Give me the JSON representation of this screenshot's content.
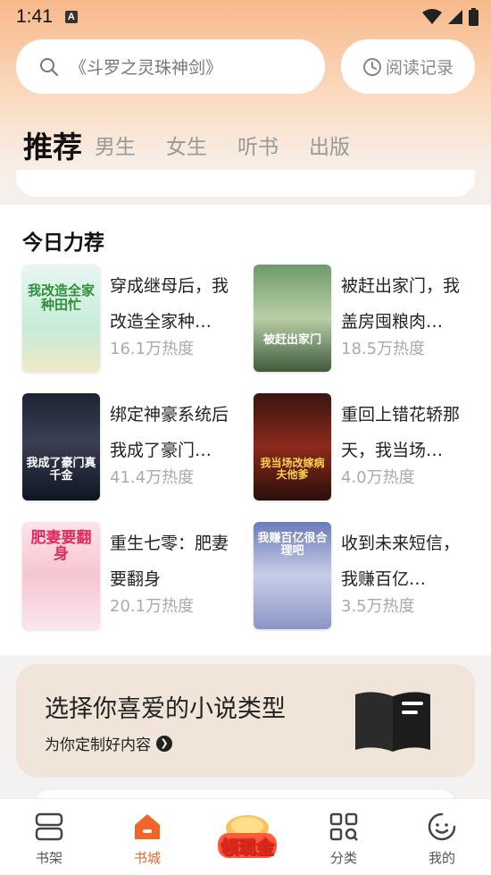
{
  "status_bar": {
    "time": "1:41",
    "notification_icon": "A"
  },
  "search": {
    "placeholder": "《斗罗之灵珠神剑》"
  },
  "history_button": {
    "label": "阅读记录"
  },
  "tabs": [
    {
      "label": "推荐",
      "active": true
    },
    {
      "label": "男生",
      "active": false
    },
    {
      "label": "女生",
      "active": false
    },
    {
      "label": "听书",
      "active": false
    },
    {
      "label": "出版",
      "active": false
    }
  ],
  "recommend": {
    "title": "今日力荐",
    "books": [
      {
        "title": "穿成继母后，我改造全家种…",
        "heat": "16.1万热度",
        "cover_text": "我改造全家种田忙"
      },
      {
        "title": "被赶出家门，我盖房囤粮肉…",
        "heat": "18.5万热度",
        "cover_text": "被赶出家门"
      },
      {
        "title": "绑定神豪系统后我成了豪门…",
        "heat": "41.4万热度",
        "cover_text": "我成了豪门真千金"
      },
      {
        "title": "重回上错花轿那天，我当场…",
        "heat": "4.0万热度",
        "cover_text": "我当场改嫁病夫他爹"
      },
      {
        "title": "重生七零：肥妻要翻身",
        "heat": "20.1万热度",
        "cover_text": "肥妻要翻身"
      },
      {
        "title": "收到未来短信，我赚百亿…",
        "heat": "3.5万热度",
        "cover_text": "我赚百亿很合理吧"
      }
    ]
  },
  "banner": {
    "title": "选择你喜爱的小说类型",
    "subtitle": "为你定制好内容"
  },
  "bottom_nav": [
    {
      "label": "书架",
      "icon": "bookshelf-icon",
      "active": false
    },
    {
      "label": "书城",
      "icon": "home-icon",
      "active": true
    },
    {
      "label": "",
      "icon": "cash-icon",
      "active": false
    },
    {
      "label": "分类",
      "icon": "category-icon",
      "active": false
    },
    {
      "label": "我的",
      "icon": "profile-icon",
      "active": false
    }
  ],
  "cash_badge": {
    "label": "领现金"
  },
  "colors": {
    "accent": "#f0652a",
    "banner_bg": "#f0e5d8"
  }
}
